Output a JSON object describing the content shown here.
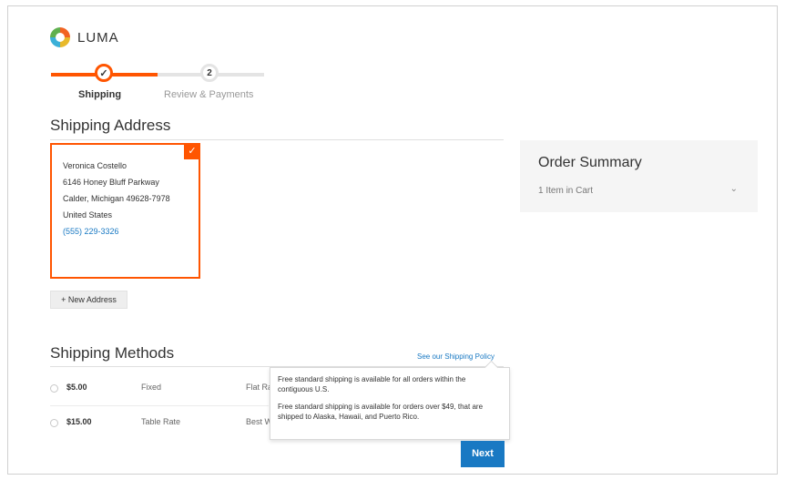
{
  "brand": {
    "name": "LUMA"
  },
  "progress": {
    "steps": [
      {
        "number": "✓",
        "label": "Shipping"
      },
      {
        "number": "2",
        "label": "Review & Payments"
      }
    ]
  },
  "shipping_address": {
    "title": "Shipping Address",
    "card": {
      "name": "Veronica Costello",
      "street": "6146 Honey Bluff Parkway",
      "city_line": "Calder, Michigan 49628-7978",
      "country": "United States",
      "phone": "(555) 229-3326",
      "check": "✓"
    },
    "new_address_label": "+ New Address"
  },
  "shipping_methods": {
    "title": "Shipping Methods",
    "policy_link": "See our Shipping Policy",
    "rows": [
      {
        "price": "$5.00",
        "method": "Fixed",
        "carrier": "Flat Rate"
      },
      {
        "price": "$15.00",
        "method": "Table Rate",
        "carrier": "Best Way"
      }
    ],
    "tooltip": [
      "Free standard shipping is available for all orders within the contiguous U.S.",
      "Free standard shipping is available for orders over $49, that are shipped to Alaska, Hawaii, and Puerto Rico."
    ],
    "next_label": "Next"
  },
  "order_summary": {
    "title": "Order Summary",
    "items_label": "1 Item in Cart",
    "chevron": "⌄"
  },
  "colors": {
    "accent": "#ff5501",
    "primary": "#1979c3"
  }
}
